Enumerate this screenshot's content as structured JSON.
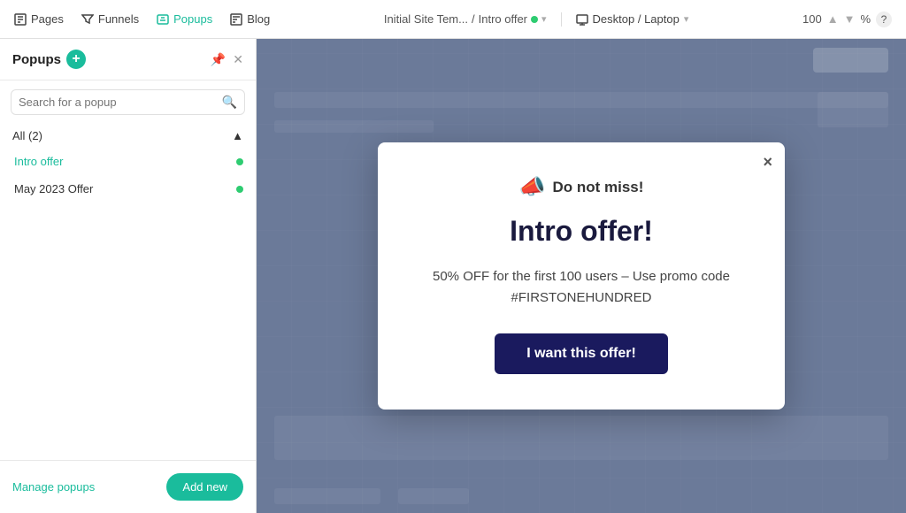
{
  "nav": {
    "items": [
      {
        "id": "pages",
        "label": "Pages",
        "active": false
      },
      {
        "id": "funnels",
        "label": "Funnels",
        "active": false
      },
      {
        "id": "popups",
        "label": "Popups",
        "active": true
      },
      {
        "id": "blog",
        "label": "Blog",
        "active": false
      }
    ],
    "breadcrumb": {
      "site": "Initial Site Tem...",
      "page": "Intro offer",
      "separator": "/"
    },
    "viewport": "Desktop / Laptop",
    "zoom": "100",
    "zoom_unit": "%",
    "help": "?"
  },
  "sidebar": {
    "title": "Popups",
    "search_placeholder": "Search for a popup",
    "section_label": "All (2)",
    "items": [
      {
        "id": "intro-offer",
        "label": "Intro offer",
        "active": true
      },
      {
        "id": "may-offer",
        "label": "May 2023 Offer",
        "active": false
      }
    ],
    "manage_label": "Manage popups",
    "add_new_label": "Add new"
  },
  "popup": {
    "close_label": "×",
    "header_icon": "📣",
    "header_text": "Do not miss!",
    "title": "Intro offer!",
    "description": "50% OFF for the first 100 users – Use promo code\n#FIRSTONEHUNDRED",
    "cta_label": "I want this offer!"
  }
}
